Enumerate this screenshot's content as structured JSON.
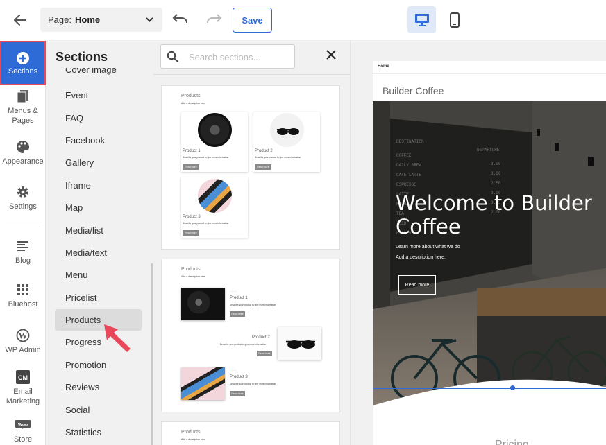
{
  "topbar": {
    "page_label": "Page:",
    "page_value": "Home",
    "save_label": "Save"
  },
  "leftnav": [
    {
      "label": "Sections",
      "icon": "plus-circle-icon"
    },
    {
      "label": "Menus & Pages",
      "icon": "pages-icon"
    },
    {
      "label": "Appearance",
      "icon": "palette-icon"
    },
    {
      "label": "Settings",
      "icon": "gear-icon"
    },
    {
      "label": "Blog",
      "icon": "blog-icon"
    },
    {
      "label": "Bluehost",
      "icon": "grid-icon"
    },
    {
      "label": "WP Admin",
      "icon": "wordpress-icon"
    },
    {
      "label": "Email Marketing",
      "icon": "cm-icon"
    },
    {
      "label": "Store",
      "icon": "woo-icon"
    }
  ],
  "sections_panel": {
    "title": "Sections",
    "items": [
      "Cover image",
      "Event",
      "FAQ",
      "Facebook",
      "Gallery",
      "Iframe",
      "Map",
      "Media/list",
      "Media/text",
      "Menu",
      "Pricelist",
      "Products",
      "Progress",
      "Promotion",
      "Reviews",
      "Social",
      "Statistics"
    ],
    "active_item": "Products"
  },
  "preview_panel": {
    "search_placeholder": "Search sections...",
    "cards": [
      {
        "title": "Products",
        "subtitle": "Add a description here",
        "products": [
          {
            "name": "Product 1",
            "desc": "Describe your product to give more information",
            "button": "Read more"
          },
          {
            "name": "Product 2",
            "desc": "Describe your product to give more information",
            "button": "Read more"
          },
          {
            "name": "Product 3",
            "desc": "Describe your product to give more information",
            "button": "Read more"
          }
        ]
      },
      {
        "title": "Products",
        "subtitle": "Add a description here",
        "products": [
          {
            "name": "Product 1",
            "desc": "Describe your product to give more information",
            "button": "Read more"
          },
          {
            "name": "Product 2",
            "desc": "Describe your product to give more information",
            "button": "Read more"
          },
          {
            "name": "Product 3",
            "desc": "Describe your product to give more information",
            "button": "Read more"
          }
        ]
      },
      {
        "title": "Products",
        "subtitle": "Add a description here"
      }
    ]
  },
  "site": {
    "nav_home": "Home",
    "brand": "Builder Coffee",
    "hero_title_line1": "Welcome to Builder",
    "hero_title_line2": "Coffee",
    "hero_sub1": "Learn more about what we do",
    "hero_sub2": "Add a description here.",
    "hero_button": "Read more",
    "pricing_heading": "Pricing"
  },
  "colors": {
    "accent": "#2e6bd6",
    "highlight_border": "#e8485a",
    "pointer": "#e8485a",
    "panel_bg": "#f1f1f1"
  }
}
